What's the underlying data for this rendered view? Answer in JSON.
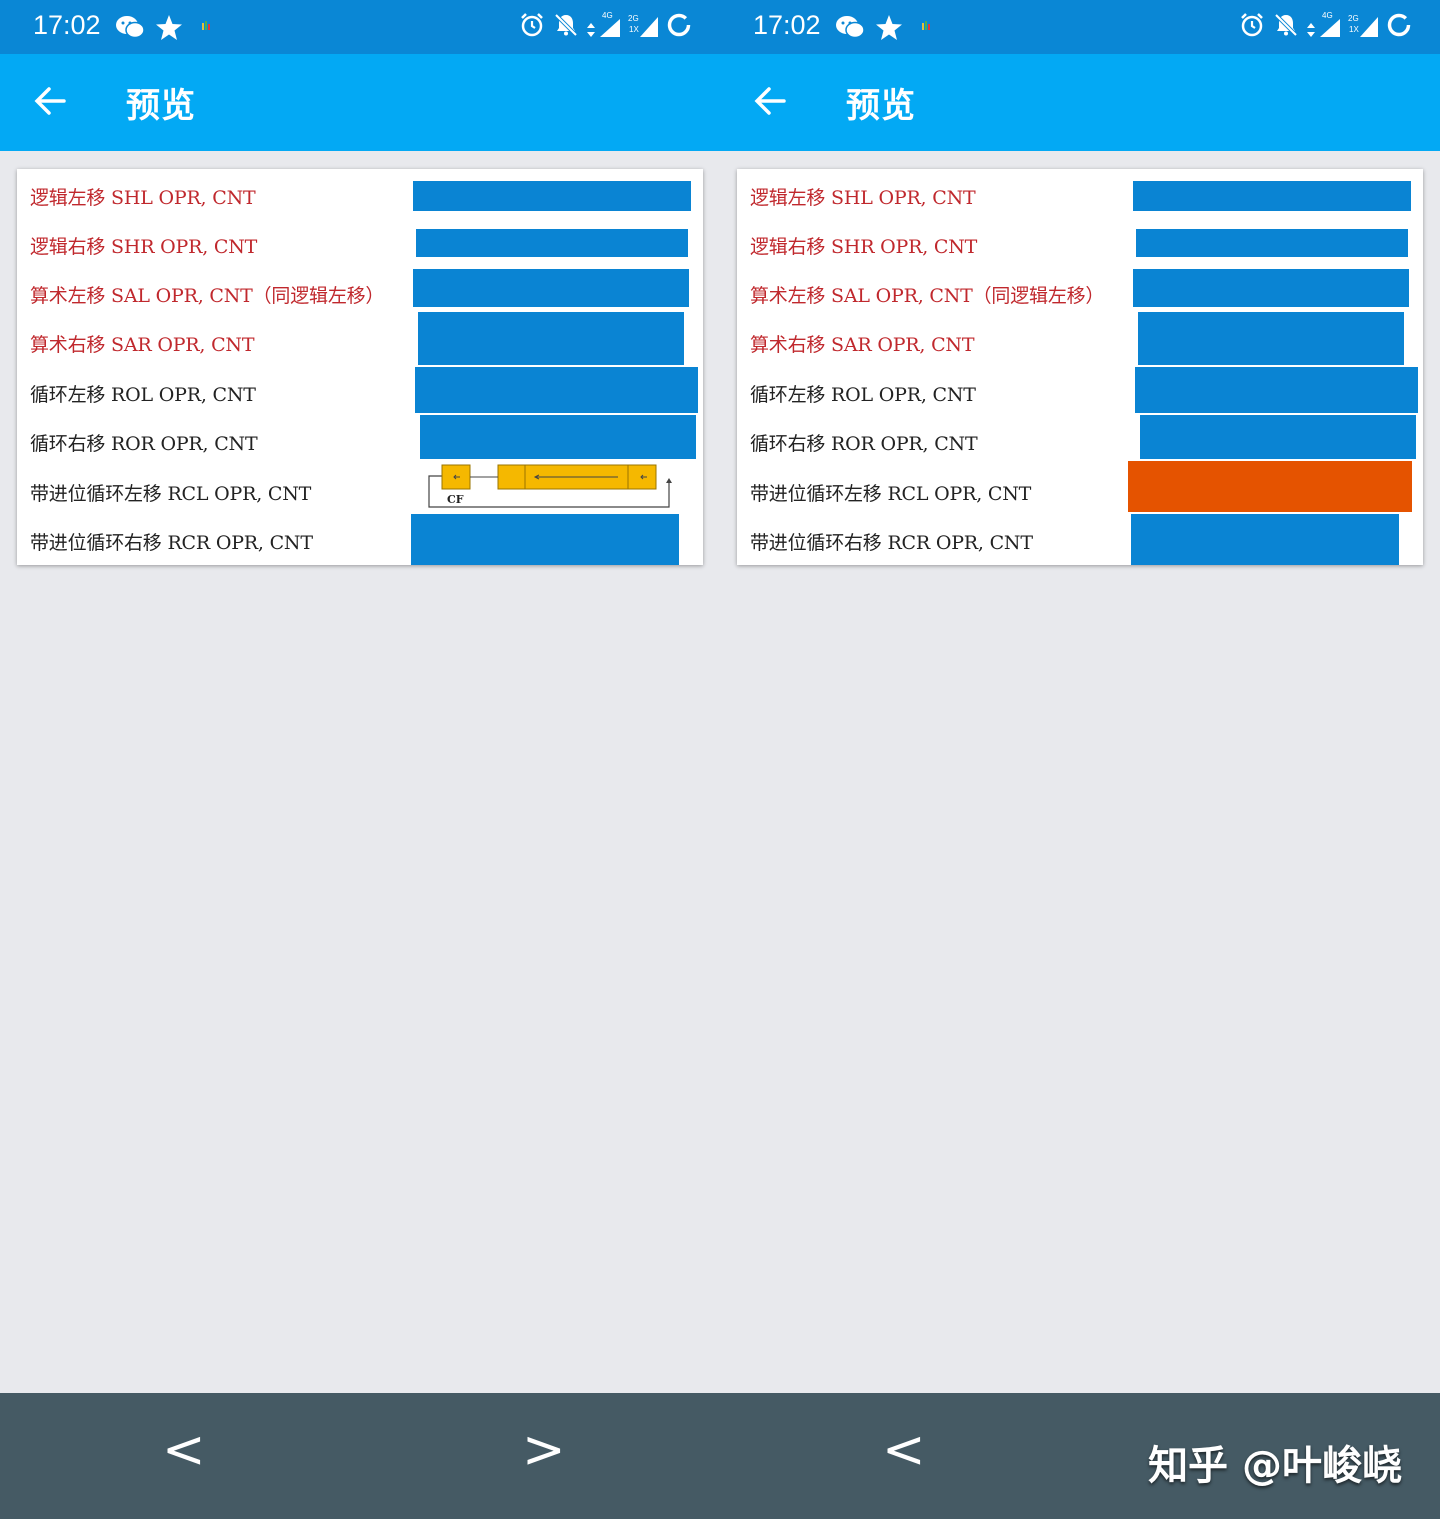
{
  "status_bar": {
    "time": "17:02",
    "net1": "4G",
    "net2": "2G",
    "net3": "1X"
  },
  "app_bar": {
    "title": "预览"
  },
  "rows": [
    {
      "label": "逻辑左移  SHL  OPR, CNT",
      "color": "#c0282d"
    },
    {
      "label": "逻辑右移  SHR  OPR, CNT",
      "color": "#c0282d"
    },
    {
      "label": "算术左移  SAL  OPR, CNT（同逻辑左移）",
      "color": "#c0282d"
    },
    {
      "label": "算术右移  SAR  OPR, CNT",
      "color": "#c0282d"
    },
    {
      "label": "循环左移  ROL  OPR, CNT",
      "color": "#222222"
    },
    {
      "label": "循环右移  ROR  OPR, CNT",
      "color": "#222222"
    },
    {
      "label": "带进位循环左移  RCL  OPR, CNT",
      "color": "#222222"
    },
    {
      "label": "带进位循环右移  RCR  OPR, CNT",
      "color": "#222222"
    }
  ],
  "diagram": {
    "cf_label": "CF"
  },
  "nav": {
    "prev": "<",
    "next": ">"
  },
  "watermark": "知乎 @叶峻峣",
  "colors": {
    "status": "#0a87d5",
    "appbar": "#03a9f4",
    "redact_blue": "#0a84d3",
    "redact_orange": "#e55300",
    "diagram_yellow": "#f5b800",
    "navbar": "#455a64"
  }
}
